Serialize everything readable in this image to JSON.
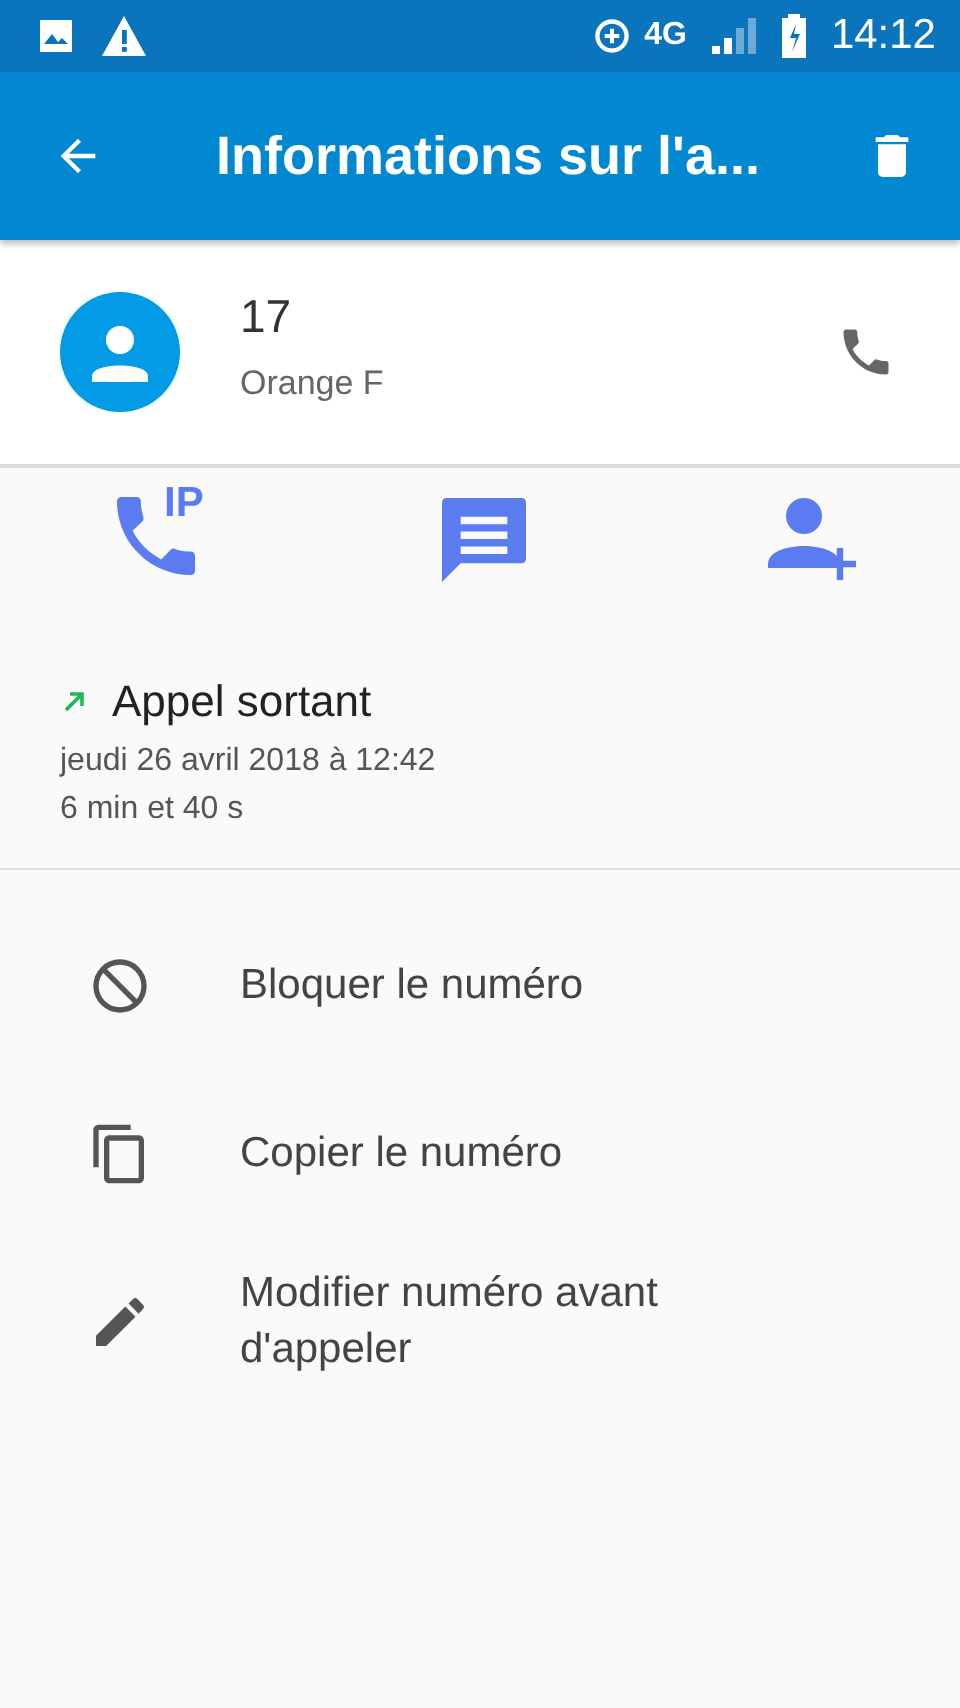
{
  "status_bar": {
    "network": "4G",
    "time": "14:12"
  },
  "app_bar": {
    "title": "Informations sur l'a..."
  },
  "contact": {
    "number": "17",
    "operator": "Orange F"
  },
  "actions": [
    {
      "kind": "ip_call",
      "label": "IP"
    },
    {
      "kind": "message"
    },
    {
      "kind": "add_contact"
    }
  ],
  "call": {
    "type": "Appel sortant",
    "date": "jeudi 26 avril 2018 à 12:42",
    "duration": "6 min et 40 s"
  },
  "menu": [
    {
      "kind": "block",
      "label": "Bloquer le numéro"
    },
    {
      "kind": "copy",
      "label": "Copier le numéro"
    },
    {
      "kind": "edit",
      "label": "Modifier numéro avant d'appeler"
    }
  ]
}
